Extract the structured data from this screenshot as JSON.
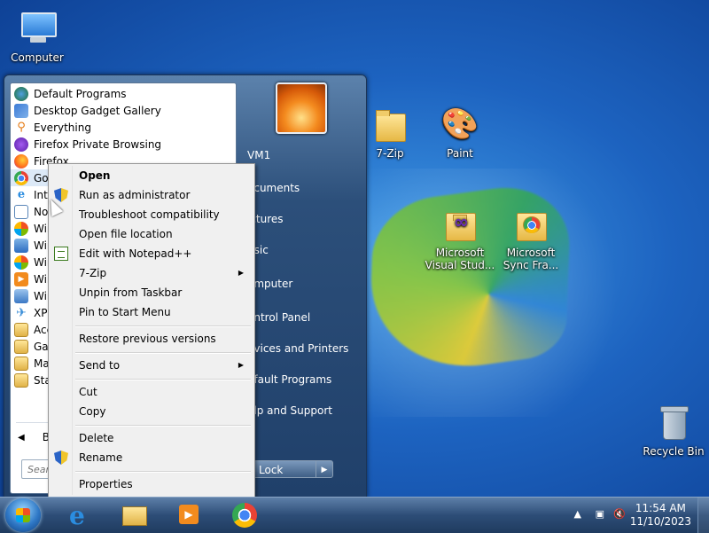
{
  "desktop": {
    "icons": [
      {
        "label": "Computer"
      },
      {
        "label": "7-Zip"
      },
      {
        "label": "Paint"
      },
      {
        "label": "Microsoft Visual Stud..."
      },
      {
        "label": "Microsoft Sync Fra..."
      },
      {
        "label": "Recycle Bin"
      }
    ]
  },
  "start_menu": {
    "programs": [
      {
        "label": "Default Programs",
        "icon": "default-programs-icon"
      },
      {
        "label": "Desktop Gadget Gallery",
        "icon": "gadget-icon"
      },
      {
        "label": "Everything",
        "icon": "search-icon"
      },
      {
        "label": "Firefox Private Browsing",
        "icon": "firefox-private-icon"
      },
      {
        "label": "Firefox",
        "icon": "firefox-icon"
      },
      {
        "label": "Goo",
        "icon": "chrome-icon"
      },
      {
        "label": "Inte",
        "icon": "ie-icon"
      },
      {
        "label": "Not",
        "icon": "notepad-icon"
      },
      {
        "label": "Win",
        "icon": "windows-icon"
      },
      {
        "label": "Win",
        "icon": "windows-icon"
      },
      {
        "label": "Win",
        "icon": "windows-icon"
      },
      {
        "label": "Win",
        "icon": "media-icon"
      },
      {
        "label": "Win",
        "icon": "windows-icon"
      },
      {
        "label": "XPS",
        "icon": "xps-icon"
      },
      {
        "label": "Acc",
        "icon": "folder-icon"
      },
      {
        "label": "Gan",
        "icon": "folder-icon"
      },
      {
        "label": "Mai",
        "icon": "folder-icon"
      },
      {
        "label": "Star",
        "icon": "folder-icon"
      }
    ],
    "back_label": "B",
    "search_placeholder": "Sear",
    "right": {
      "user": "VM1",
      "items": [
        "ocuments",
        "ictures",
        "usic",
        "omputer",
        "ontrol Panel",
        "evices and Printers",
        "efault Programs",
        "elp and Support"
      ],
      "lock_label": "Lock"
    }
  },
  "context_menu": {
    "items": [
      {
        "label": "Open",
        "bold": true
      },
      {
        "label": "Run as administrator",
        "icon": "shield-icon"
      },
      {
        "label": "Troubleshoot compatibility"
      },
      {
        "label": "Open file location"
      },
      {
        "label": "Edit with Notepad++",
        "icon": "notepad-plus-icon"
      },
      {
        "label": "7-Zip",
        "submenu": true
      },
      {
        "label": "Unpin from Taskbar"
      },
      {
        "label": "Pin to Start Menu"
      },
      {
        "label": "Restore previous versions"
      },
      {
        "label": "Send to",
        "submenu": true
      },
      {
        "label": "Cut"
      },
      {
        "label": "Copy"
      },
      {
        "label": "Delete"
      },
      {
        "label": "Rename",
        "icon": "shield-icon"
      },
      {
        "label": "Properties"
      }
    ]
  },
  "taskbar": {
    "clock_time": "11:54 AM",
    "clock_date": "11/10/2023"
  }
}
